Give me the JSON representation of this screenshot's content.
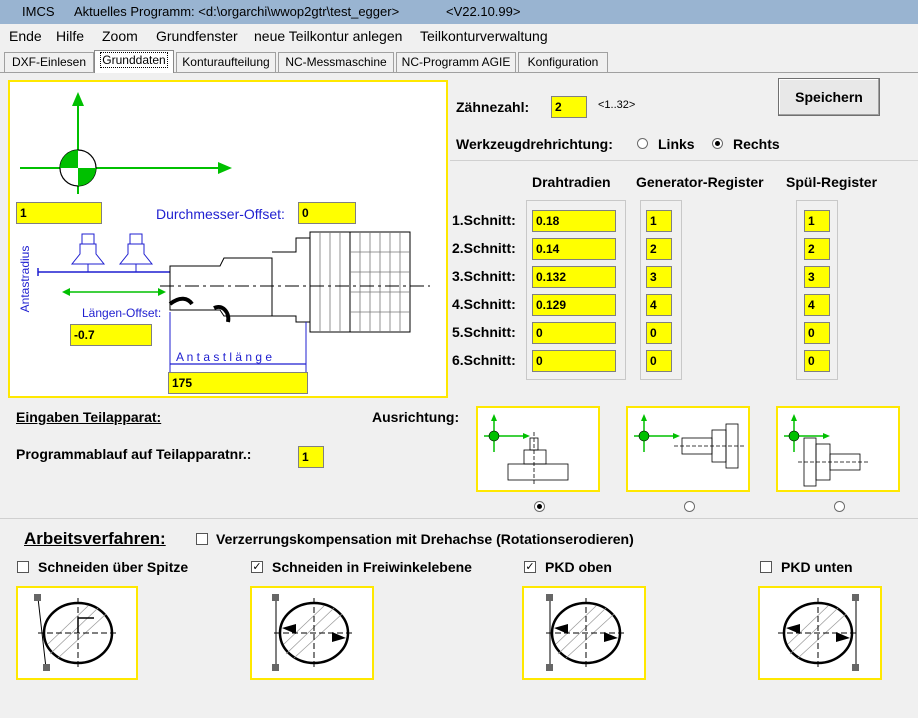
{
  "window": {
    "app": "IMCS",
    "title": "Aktuelles Programm: <d:\\orgarchi\\wwop2gtr\\test_egger>",
    "version": "<V22.10.99>"
  },
  "menu": [
    "Ende",
    "Hilfe",
    "Zoom",
    "Grundfenster",
    "neue Teilkontur anlegen",
    "Teilkonturverwaltung"
  ],
  "tabs": [
    "DXF-Einlesen",
    "Grunddaten",
    "Konturaufteilung",
    "NC-Messmaschine",
    "NC-Programm AGIE",
    "Konfiguration"
  ],
  "active_tab": "Grunddaten",
  "drawing": {
    "top_field": "1",
    "durchmesser_label": "Durchmesser-Offset:",
    "durchmesser_value": "0",
    "antastradius_label": "Antastradius",
    "laengen_label": "Längen-Offset:",
    "laengen_value": "-0.7",
    "antastlaenge_label": "A n t a s t l ä n g e",
    "antastlaenge_value": "175"
  },
  "zaehnezahl": {
    "label": "Zähnezahl:",
    "value": "2",
    "range": "<1..32>"
  },
  "save_label": "Speichern",
  "werkzeug": {
    "label": "Werkzeugdrehrichtung:",
    "links": "Links",
    "rechts": "Rechts",
    "selected": "Rechts"
  },
  "table": {
    "headers": [
      "Drahtradien",
      "Generator-Register",
      "Spül-Register"
    ],
    "rows": [
      {
        "label": "1.Schnitt:",
        "draht": "0.18",
        "gen": "1",
        "spuel": "1"
      },
      {
        "label": "2.Schnitt:",
        "draht": "0.14",
        "gen": "2",
        "spuel": "2"
      },
      {
        "label": "3.Schnitt:",
        "draht": "0.132",
        "gen": "3",
        "spuel": "3"
      },
      {
        "label": "4.Schnitt:",
        "draht": "0.129",
        "gen": "4",
        "spuel": "4"
      },
      {
        "label": "5.Schnitt:",
        "draht": "0",
        "gen": "0",
        "spuel": "0"
      },
      {
        "label": "6.Schnitt:",
        "draht": "0",
        "gen": "0",
        "spuel": "0"
      }
    ]
  },
  "teilapparat": {
    "heading": "Eingaben Teilapparat:",
    "prog_label": "Programmablauf auf Teilapparatnr.:",
    "prog_value": "1",
    "ausrichtung_label": "Ausrichtung:",
    "selected_orientation": 1
  },
  "arbeitsverfahren": {
    "heading": "Arbeitsverfahren:",
    "verzerrung_label": "Verzerrungskompensation mit Drehachse (Rotationserodieren)",
    "verzerrung_checked": false,
    "options": [
      {
        "label": "Schneiden über Spitze",
        "checked": false
      },
      {
        "label": "Schneiden in Freiwinkelebene",
        "checked": true
      },
      {
        "label": "PKD oben",
        "checked": true
      },
      {
        "label": "PKD unten",
        "checked": false
      }
    ]
  },
  "colors": {
    "highlight_yellow": "#ffff00",
    "frame_yellow": "#ffe800",
    "green": "#00c000",
    "blue": "#1f1fd0",
    "titlebar": "#99b4d1"
  }
}
